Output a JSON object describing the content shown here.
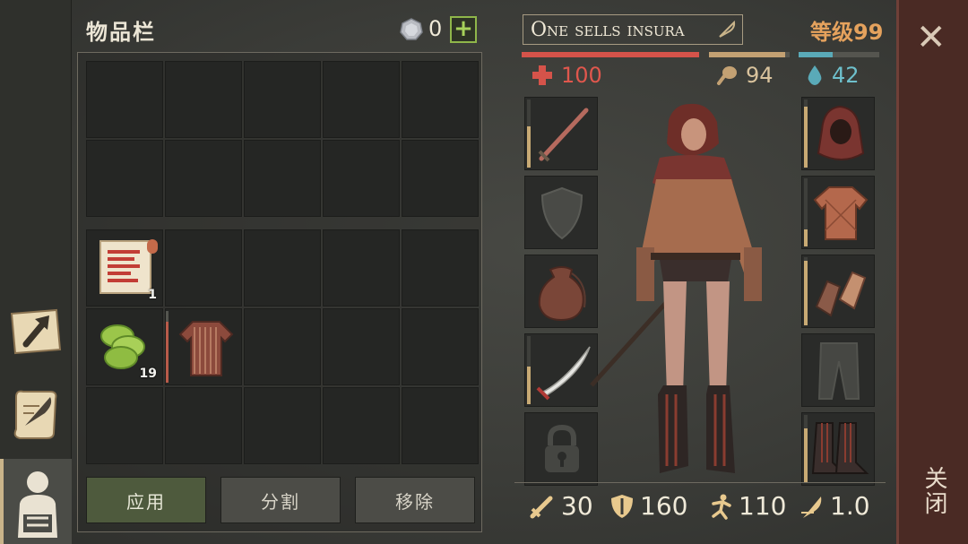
{
  "inventory": {
    "title": "物品栏",
    "currency": {
      "count": "0",
      "add_label": "+"
    },
    "items": [
      {
        "icon": "recipe-scroll-icon",
        "qty": "1"
      },
      {
        "icon": "green-bandage-icon",
        "qty": "19"
      },
      {
        "icon": "chainmail-shirt-icon",
        "durability_pct": 0.85
      }
    ],
    "buttons": {
      "apply": "应用",
      "split": "分割",
      "remove": "移除"
    }
  },
  "character": {
    "name": "One sells insura",
    "level": "等级99",
    "health": {
      "value": "100",
      "pct": 1.0,
      "color": "#d5534a"
    },
    "hunger": {
      "value": "94",
      "pct": 0.94,
      "color": "#c3a173"
    },
    "thirst": {
      "value": "42",
      "pct": 0.42,
      "color": "#5aaab8"
    },
    "stats": {
      "attack": "30",
      "defense": "160",
      "speed": "110",
      "weight": "1.0"
    },
    "slots_left": [
      {
        "name": "weapon-slot",
        "icon": "sword-icon",
        "durability_pct": 0.6
      },
      {
        "name": "shield-slot",
        "icon": "shield-icon"
      },
      {
        "name": "bag-slot",
        "icon": "pouch-icon"
      },
      {
        "name": "secondary-weapon-slot",
        "icon": "sabre-icon",
        "durability_pct": 0.55
      },
      {
        "name": "locked-slot",
        "icon": "lock-icon"
      }
    ],
    "slots_right": [
      {
        "name": "head-slot",
        "icon": "hood-icon",
        "durability_pct": 0.9
      },
      {
        "name": "body-slot",
        "icon": "quilted-tunic-icon",
        "durability_pct": 0.25
      },
      {
        "name": "hands-slot",
        "icon": "gloves-icon",
        "durability_pct": 0.95
      },
      {
        "name": "legs-slot",
        "icon": "pants-icon"
      },
      {
        "name": "feet-slot",
        "icon": "boots-icon",
        "durability_pct": 0.8
      }
    ]
  },
  "close": {
    "label": "关闭"
  },
  "colors": {
    "accent": "#c9b48a",
    "apply_button": "#4e5a3d",
    "close_panel": "#4a2a24",
    "level": "#e5a25d"
  }
}
